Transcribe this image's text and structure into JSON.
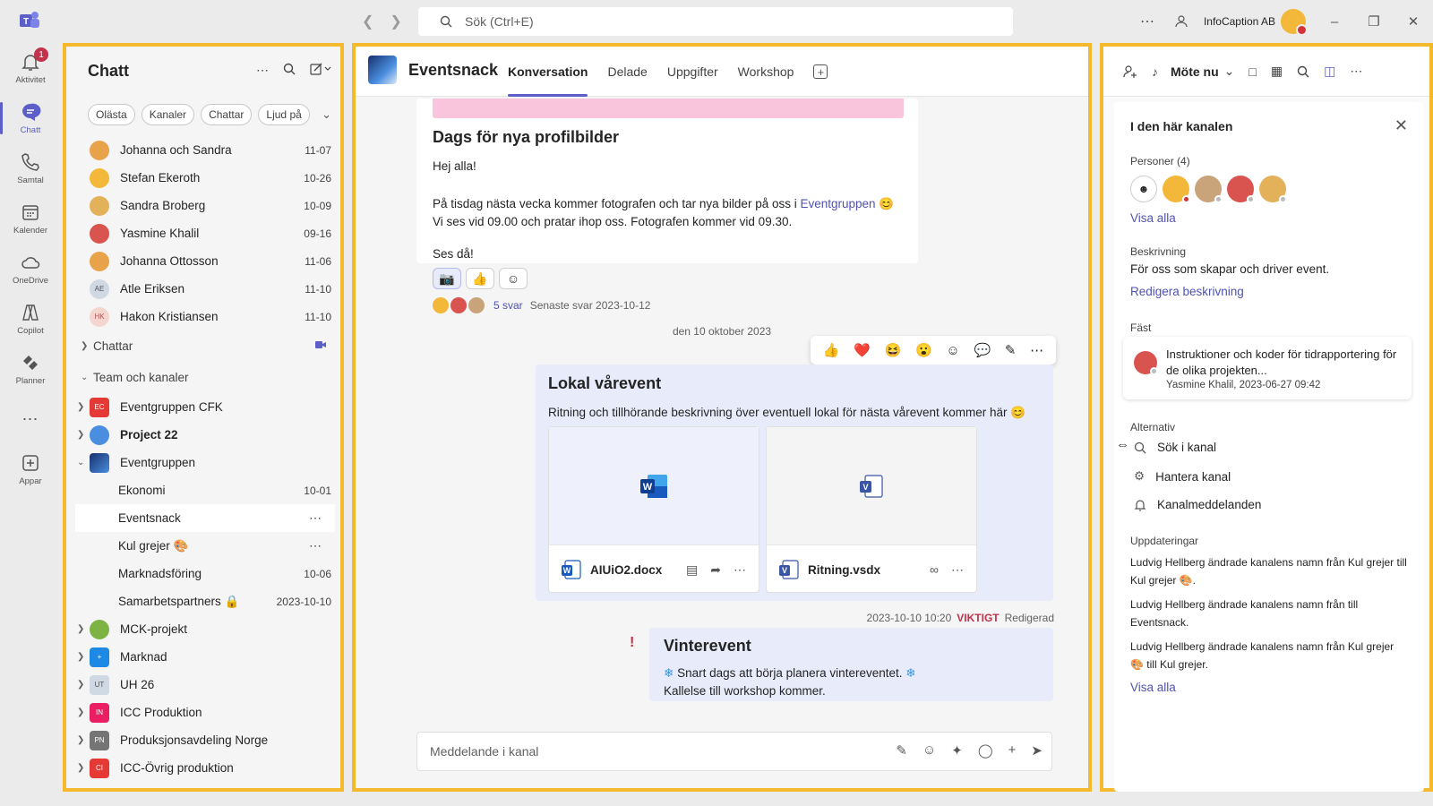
{
  "titlebar": {
    "search_placeholder": "Sök (Ctrl+E)",
    "org_name": "InfoCaption AB"
  },
  "rail": {
    "items": [
      {
        "label": "Aktivitet",
        "icon": "bell-icon",
        "badge": "1"
      },
      {
        "label": "Chatt",
        "icon": "chat-icon"
      },
      {
        "label": "Samtal",
        "icon": "phone-icon"
      },
      {
        "label": "Kalender",
        "icon": "calendar-icon"
      },
      {
        "label": "OneDrive",
        "icon": "cloud-icon"
      },
      {
        "label": "Copilot",
        "icon": "copilot-icon"
      },
      {
        "label": "Planner",
        "icon": "planner-icon"
      },
      {
        "label": "",
        "icon": "more-icon"
      },
      {
        "label": "Appar",
        "icon": "apps-icon"
      }
    ]
  },
  "chatlist": {
    "title": "Chatt",
    "filters": [
      "Olästa",
      "Kanaler",
      "Chattar",
      "Ljud på"
    ],
    "chats": [
      {
        "name": "Johanna och Sandra",
        "date": "11-07",
        "color": "#e8a24a"
      },
      {
        "name": "Stefan Ekeroth",
        "date": "10-26",
        "color": "#f3b73a"
      },
      {
        "name": "Sandra Broberg",
        "date": "10-09",
        "color": "#e3b15a"
      },
      {
        "name": "Yasmine Khalil",
        "date": "09-16",
        "color": "#d9534f"
      },
      {
        "name": "Johanna Ottosson",
        "date": "11-06",
        "color": "#e8a24a"
      },
      {
        "name": "Atle Eriksen",
        "date": "11-10",
        "color": "#cfd8e3",
        "initials": "AE"
      },
      {
        "name": "Hakon Kristiansen",
        "date": "11-10",
        "color": "#f4d5cf",
        "initials": "HK"
      }
    ],
    "section_chats": "Chattar",
    "section_teams": "Team och kanaler",
    "teams": [
      {
        "name": "Eventgruppen CFK",
        "color": "#e53935",
        "initials": "EC"
      },
      {
        "name": "Project 22",
        "color": "#4a8ee0",
        "bold": true
      },
      {
        "name": "Eventgruppen",
        "color": "#16306b"
      }
    ],
    "channels": [
      {
        "name": "Ekonomi",
        "date": "10-01"
      },
      {
        "name": "Eventsnack",
        "date": ""
      },
      {
        "name": "Kul grejer 🎨",
        "date": ""
      },
      {
        "name": "Marknadsföring",
        "date": "10-06"
      },
      {
        "name": "Samarbetspartners 🔒",
        "date": "2023-10-10"
      }
    ],
    "more_teams": [
      {
        "name": "MCK-projekt",
        "color": "#7cb342"
      },
      {
        "name": "Marknad",
        "color": "#1e88e5",
        "initials": "+"
      },
      {
        "name": "UH 26",
        "color": "#cfd8e3",
        "initials": "UT"
      },
      {
        "name": "ICC Produktion",
        "color": "#e91e63",
        "initials": "IN"
      },
      {
        "name": "Produksjonsavdeling Norge",
        "color": "#757575",
        "initials": "PN"
      },
      {
        "name": "ICC-Övrig produktion",
        "color": "#e53935",
        "initials": "CI"
      }
    ]
  },
  "channel": {
    "name": "Eventsnack",
    "tabs": [
      "Konversation",
      "Delade",
      "Uppgifter",
      "Workshop"
    ]
  },
  "messages": {
    "m1": {
      "title": "Dags för nya profilbilder",
      "greeting": "Hej alla!",
      "body_a": "På tisdag nästa vecka kommer fotografen och tar nya bilder på oss i ",
      "mention": "Eventgruppen",
      "body_b": " 😊",
      "body_c": "Vi ses vid 09.00 och pratar ihop oss. Fotografen kommer vid 09.30.",
      "closing": "Ses då!",
      "reactions": [
        "📷",
        "👍",
        "☺"
      ],
      "reply_count": "5 svar",
      "last_reply": "Senaste svar 2023-10-12"
    },
    "date_separator": "den 10 oktober 2023",
    "hover_actions": [
      "👍",
      "❤️",
      "😆",
      "😮",
      "☺",
      "💬",
      "✎",
      "⋯"
    ],
    "m2": {
      "title": "Lokal vårevent",
      "desc": "Ritning och tillhörande beskrivning över eventuell lokal för nästa vårevent kommer här 😊",
      "files": [
        {
          "name": "AIUiO2.docx",
          "type": "W"
        },
        {
          "name": "Ritning.vsdx",
          "type": "V"
        }
      ]
    },
    "m3": {
      "timestamp": "2023-10-10 10:20",
      "importance": "VIKTIGT",
      "edited": "Redigerad",
      "title": "Vinterevent",
      "line1": "Snart dags att börja planera vintereventet.",
      "line2": "Kallelse till workshop kommer.",
      "snow": "❄"
    },
    "composer_placeholder": "Meddelande i kanal"
  },
  "rightpanel": {
    "meet_label": "Möte nu",
    "title": "I den här kanalen",
    "people_label": "Personer (4)",
    "see_all": "Visa alla",
    "desc_label": "Beskrivning",
    "desc_text": "För oss som skapar och driver event.",
    "edit_desc": "Redigera beskrivning",
    "pinned_label": "Fäst",
    "pinned_text": "Instruktioner och koder för tidrapportering för de olika projekten...",
    "pinned_meta": "Yasmine Khalil, 2023-06-27 09:42",
    "options_label": "Alternativ",
    "options": [
      "Sök i kanal",
      "Hantera kanal",
      "Kanalmeddelanden"
    ],
    "updates_label": "Uppdateringar",
    "updates": [
      "Ludvig Hellberg ändrade kanalens namn från Kul grejer till Kul grejer 🎨.",
      "Ludvig Hellberg ändrade kanalens namn från till Eventsnack.",
      "Ludvig Hellberg ändrade kanalens namn från Kul grejer 🎨 till Kul grejer."
    ],
    "see_all_updates": "Visa alla"
  },
  "colors": {
    "accent": "#5b5fc7",
    "frame": "#f5b92e",
    "important": "#c4314b"
  }
}
